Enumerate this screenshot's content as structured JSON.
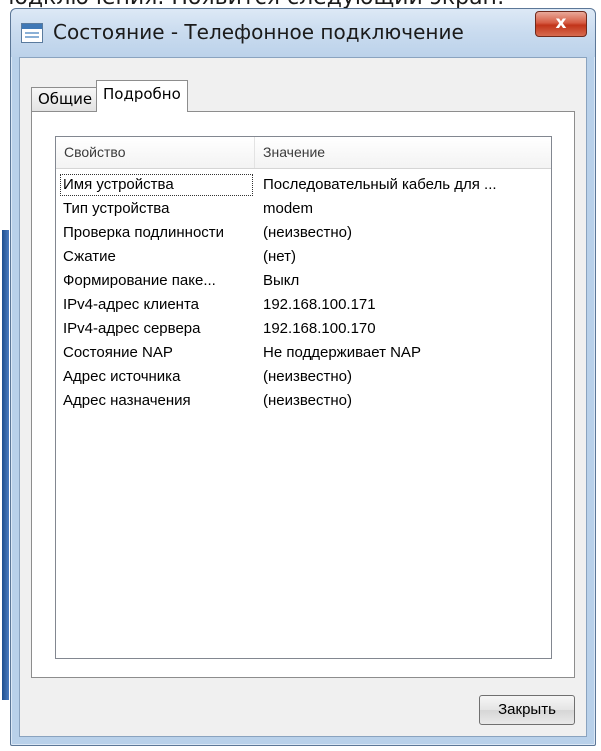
{
  "caption_top": "подключения. Появится следующий экран:",
  "window": {
    "title": "Состояние - Телефонное подключение",
    "close_glyph": "x"
  },
  "tabs": [
    {
      "label": "Общие"
    },
    {
      "label": "Подробно"
    }
  ],
  "details": {
    "columns": [
      "Свойство",
      "Значение"
    ],
    "rows": [
      {
        "property": "Имя устройства",
        "value": "Последовательный кабель для ..."
      },
      {
        "property": "Тип устройства",
        "value": "modem"
      },
      {
        "property": "Проверка подлинности",
        "value": "(неизвестно)"
      },
      {
        "property": "Сжатие",
        "value": "(нет)"
      },
      {
        "property": "Формирование паке...",
        "value": "Выкл"
      },
      {
        "property": "IPv4-адрес клиента",
        "value": "192.168.100.171"
      },
      {
        "property": "IPv4-адрес сервера",
        "value": "192.168.100.170"
      },
      {
        "property": "Состояние NAP",
        "value": "Не поддерживает NAP"
      },
      {
        "property": "Адрес источника",
        "value": "(неизвестно)"
      },
      {
        "property": "Адрес назначения",
        "value": "(неизвестно)"
      }
    ]
  },
  "buttons": {
    "close_label": "Закрыть"
  }
}
